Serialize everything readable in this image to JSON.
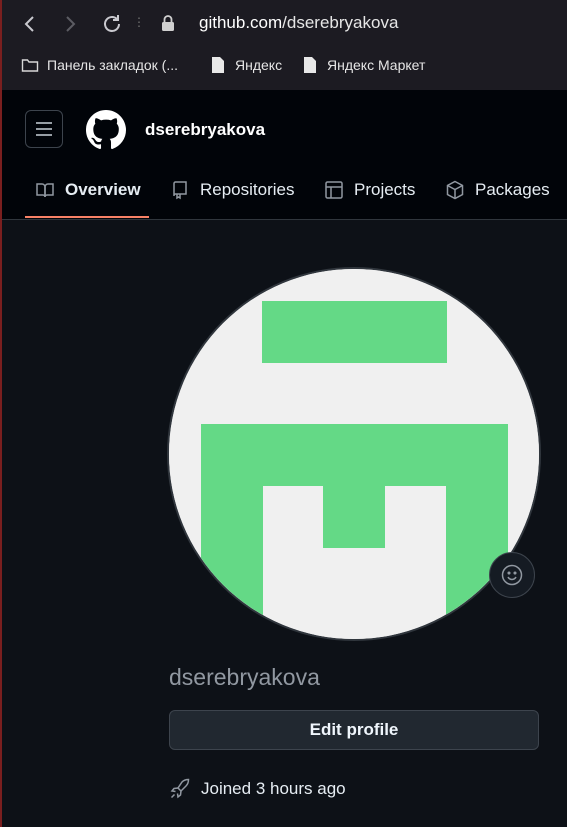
{
  "browser": {
    "url_host": "github.com",
    "url_path": "/dserebryakova",
    "bookmarks": [
      {
        "label": "Панель закладок (..."
      },
      {
        "label": "Яндекс"
      },
      {
        "label": "Яндекс Маркет"
      }
    ]
  },
  "header": {
    "username": "dserebryakova"
  },
  "tabs": [
    {
      "label": "Overview",
      "icon": "book-icon",
      "active": true
    },
    {
      "label": "Repositories",
      "icon": "repo-icon"
    },
    {
      "label": "Projects",
      "icon": "table-icon"
    },
    {
      "label": "Packages",
      "icon": "package-icon"
    }
  ],
  "profile": {
    "name": "dserebryakova",
    "edit_label": "Edit profile",
    "joined": "Joined 3 hours ago"
  },
  "colors": {
    "accent_underline": "#f78166",
    "identicon": "#64d986",
    "background": "#0d1117"
  }
}
